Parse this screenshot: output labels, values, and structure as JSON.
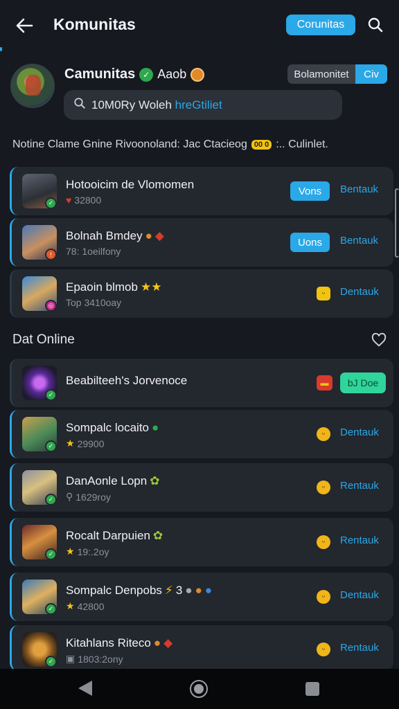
{
  "header": {
    "title": "Komunitas",
    "chip_label": "Corunitas"
  },
  "profile": {
    "name": "Camunitas",
    "sub": "Aaob",
    "segment": {
      "left": "Bolamonitet",
      "right": "Civ"
    },
    "search_value": "10M0Ry Woleh",
    "search_highlight": "hreGtiliet"
  },
  "notice": {
    "text": "Notine Clame Gnine Rivoonoland: Jac Ctacieog",
    "chip": "00 0",
    "trailing": ":.. Culinlet."
  },
  "list_top": [
    {
      "title": "Hotooicim de Vlomomen",
      "meta": "32800",
      "meta_icon": "heart",
      "button": "Vons",
      "link": "Bentauk",
      "badge_color": "#2fa84f"
    },
    {
      "title": "Bolnah Bmdey",
      "meta": "78: 1oeilfony",
      "meta_icon": "none",
      "button": "Uons",
      "link": "Bentauk",
      "badge_color": "#e05a2a"
    },
    {
      "title": "Epaoin blmob",
      "meta": "Top 3410oay",
      "meta_icon": "none",
      "button": "",
      "link": "Dentauk",
      "badge_color": "#c72a8a"
    }
  ],
  "section": {
    "title": "Dat Online"
  },
  "list_online": [
    {
      "title": "Beabilteeh's Jorvenoce",
      "meta": "",
      "meta_icon": "none",
      "green_button": "bJ Doe",
      "badge_color": "#2fa84f"
    },
    {
      "title": "Sompalc locaito",
      "meta": "29900",
      "meta_icon": "star",
      "link": "Dentauk",
      "badge_color": "#2fa84f"
    },
    {
      "title": "DanAonle Lopn",
      "meta": "1629roy",
      "meta_icon": "person",
      "link": "Rentauk",
      "badge_color": "#2fa84f"
    },
    {
      "title": "Rocalt Darpuien",
      "meta": "19:.2oy",
      "meta_icon": "star",
      "link": "Rentauk",
      "badge_color": "#2fa84f"
    },
    {
      "title": "Sompalc Denpobs",
      "meta": "42800",
      "meta_icon": "star",
      "link": "Dentauk",
      "badge_color": "#2fa84f",
      "title_suffix": "3"
    },
    {
      "title": "Kitahlans Riteco",
      "meta": "1803:2ony",
      "meta_icon": "box",
      "link": "Rentauk",
      "badge_color": "#2fa84f"
    }
  ],
  "colors": {
    "accent": "#2aa8e8",
    "background": "#16191f",
    "card": "#23272e",
    "green_action": "#2fd59a",
    "badge_yellow": "#f1c40f"
  },
  "icons": [
    "back-arrow-icon",
    "search-icon",
    "heart-icon",
    "star-icon",
    "nav-back-icon",
    "nav-home-icon",
    "nav-recent-icon"
  ]
}
